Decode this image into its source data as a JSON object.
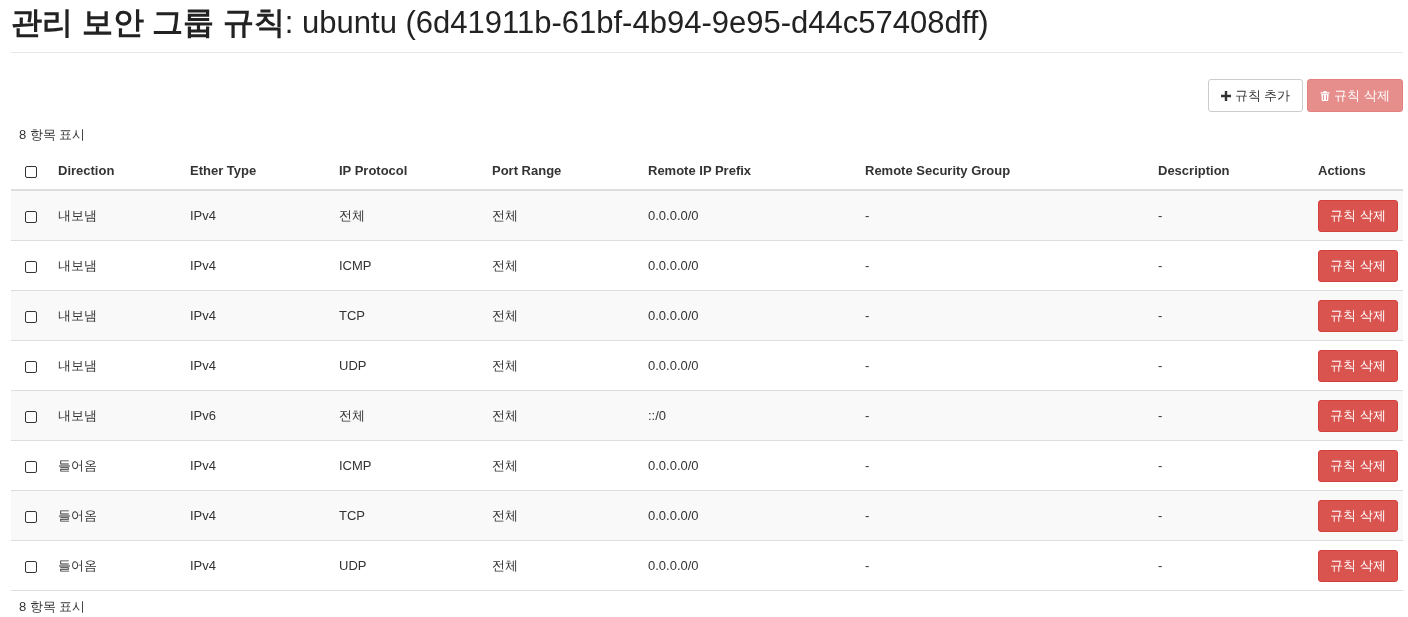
{
  "page": {
    "title": "**관리 보안 그룹 규칙**: ubuntu (6d41911b-61bf-4b94-9e95-d44c57408dff)"
  },
  "toolbar": {
    "buttons": [
      {
        "label": "규칙 추가",
        "kind": "add",
        "disabled": false
      },
      {
        "label": "규칙 삭제",
        "kind": "delete",
        "disabled": true
      }
    ]
  },
  "table": {
    "summary_top": "8 항목 표시",
    "select_all": {
      "checked": false
    },
    "columns": [
      "Direction",
      "Ether Type",
      "IP Protocol",
      "Port Range",
      "Remote IP Prefix",
      "Remote Security Group",
      "Description",
      "Actions"
    ],
    "rows": [
      {
        "checked": false,
        "cells": [
          "내보냄",
          "IPv4",
          "전체",
          "전체",
          "0.0.0.0/0",
          "-",
          "-"
        ],
        "action": "규칙 삭제"
      },
      {
        "checked": false,
        "cells": [
          "내보냄",
          "IPv4",
          "ICMP",
          "전체",
          "0.0.0.0/0",
          "-",
          "-"
        ],
        "action": "규칙 삭제"
      },
      {
        "checked": false,
        "cells": [
          "내보냄",
          "IPv4",
          "TCP",
          "전체",
          "0.0.0.0/0",
          "-",
          "-"
        ],
        "action": "규칙 삭제"
      },
      {
        "checked": false,
        "cells": [
          "내보냄",
          "IPv4",
          "UDP",
          "전체",
          "0.0.0.0/0",
          "-",
          "-"
        ],
        "action": "규칙 삭제"
      },
      {
        "checked": false,
        "cells": [
          "내보냄",
          "IPv6",
          "전체",
          "전체",
          "::/0",
          "-",
          "-"
        ],
        "action": "규칙 삭제"
      },
      {
        "checked": false,
        "cells": [
          "들어옴",
          "IPv4",
          "ICMP",
          "전체",
          "0.0.0.0/0",
          "-",
          "-"
        ],
        "action": "규칙 삭제"
      },
      {
        "checked": false,
        "cells": [
          "들어옴",
          "IPv4",
          "TCP",
          "전체",
          "0.0.0.0/0",
          "-",
          "-"
        ],
        "action": "규칙 삭제"
      },
      {
        "checked": false,
        "cells": [
          "들어옴",
          "IPv4",
          "UDP",
          "전체",
          "0.0.0.0/0",
          "-",
          "-"
        ],
        "action": "규칙 삭제"
      }
    ],
    "summary_bottom": "8 항목 표시"
  }
}
